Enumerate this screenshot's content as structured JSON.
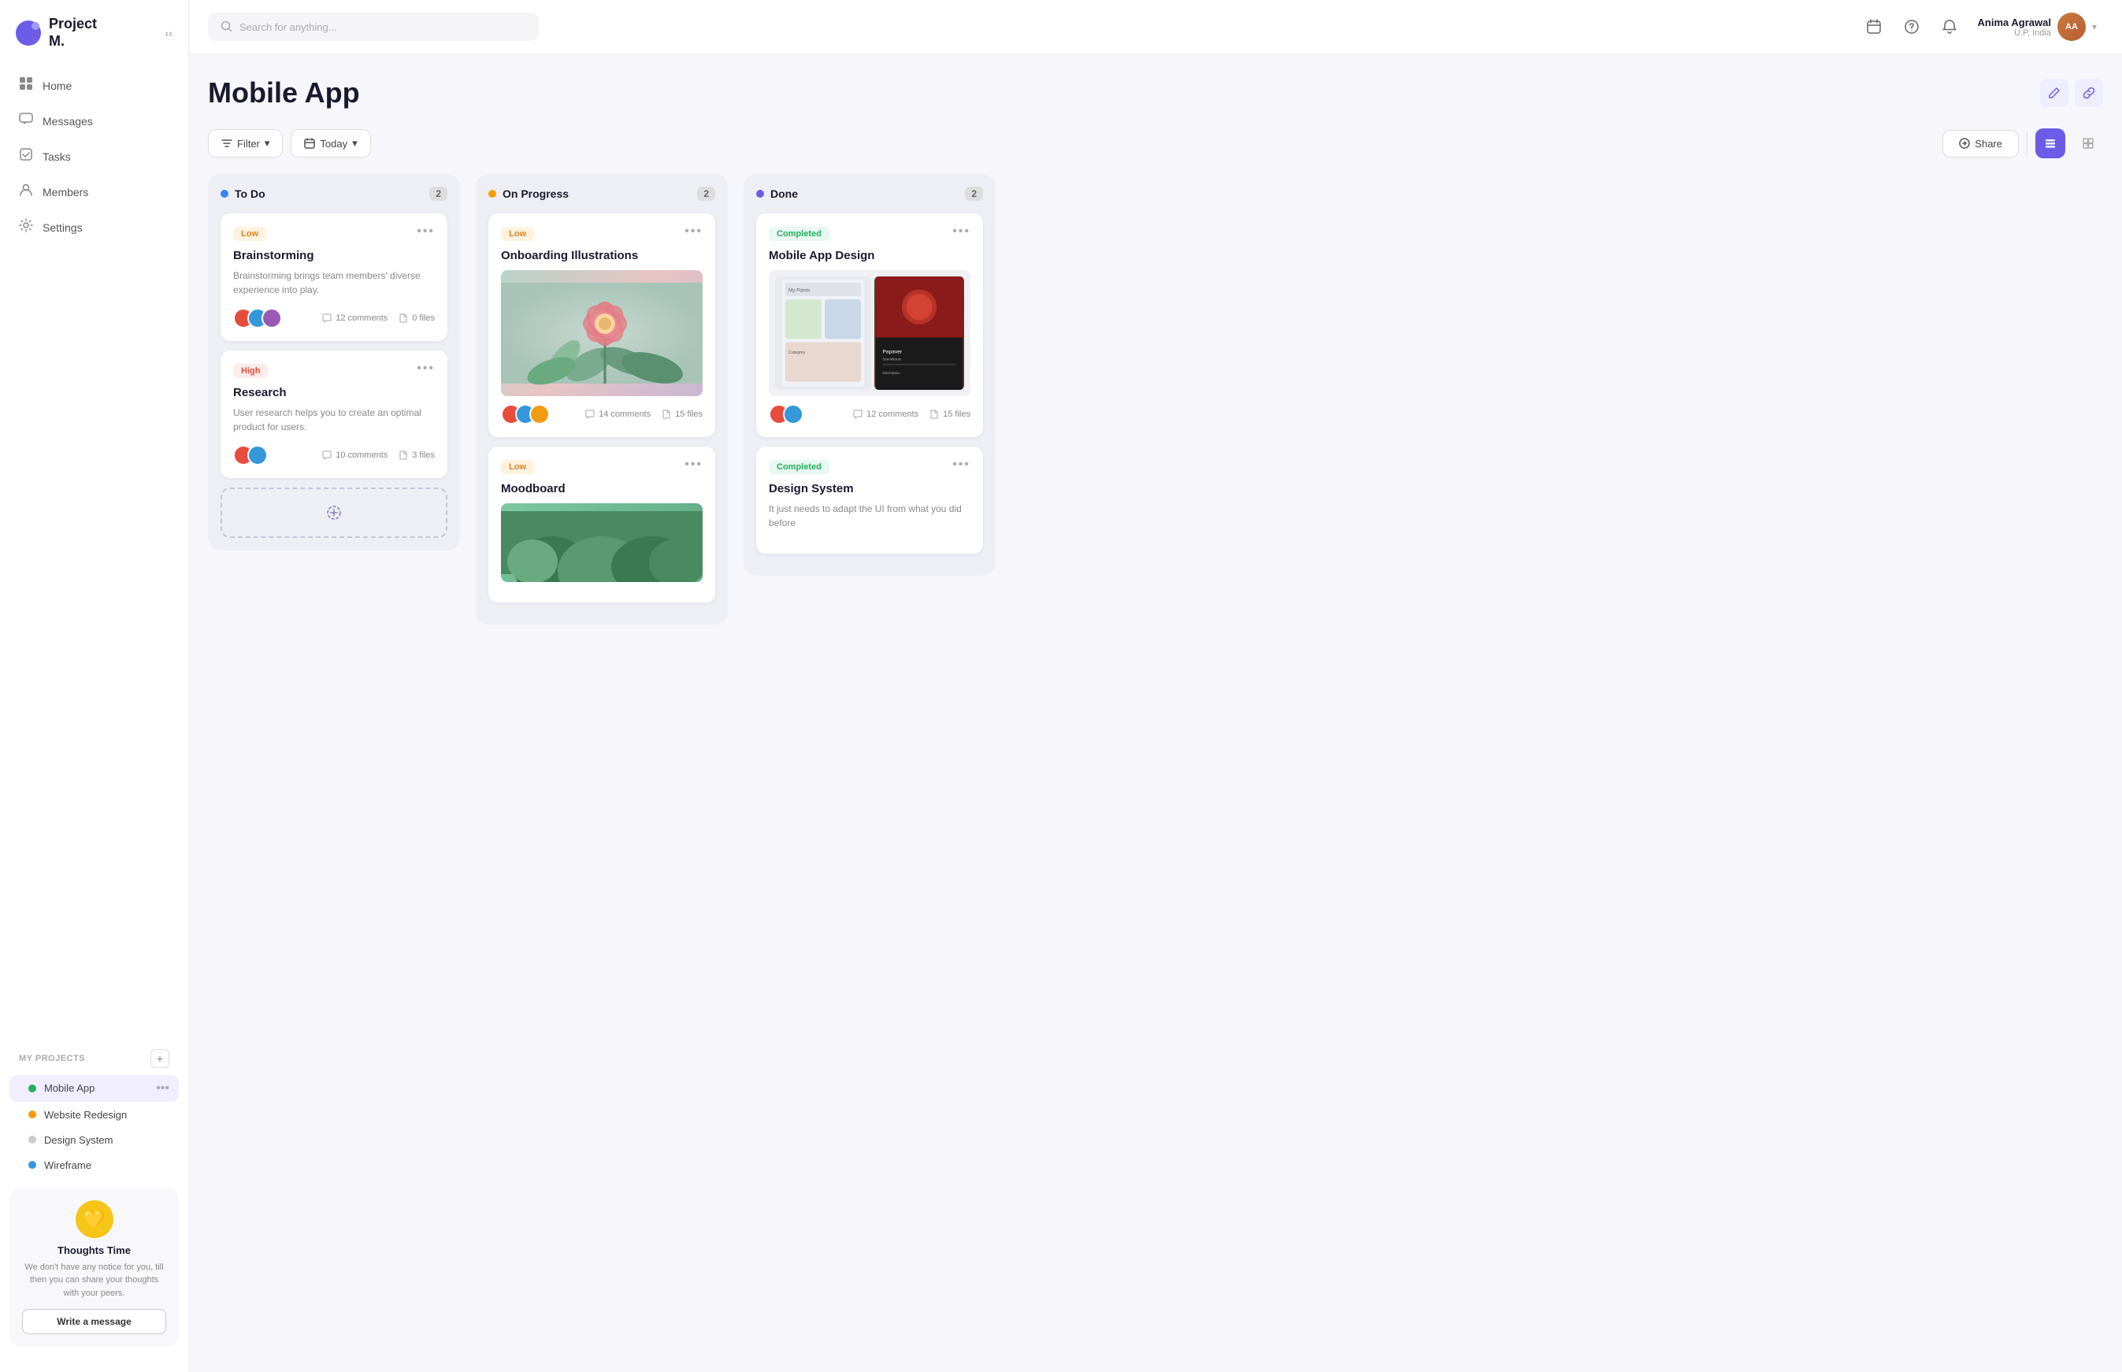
{
  "brand": {
    "name": "Project\nM.",
    "icon": "P"
  },
  "sidebar": {
    "nav_items": [
      {
        "id": "home",
        "label": "Home",
        "icon": "⊞"
      },
      {
        "id": "messages",
        "label": "Messages",
        "icon": "💬"
      },
      {
        "id": "tasks",
        "label": "Tasks",
        "icon": "☑"
      },
      {
        "id": "members",
        "label": "Members",
        "icon": "👤"
      },
      {
        "id": "settings",
        "label": "Settings",
        "icon": "⚙"
      }
    ],
    "projects_label": "MY PROJECTS",
    "projects": [
      {
        "id": "mobile-app",
        "label": "Mobile App",
        "color": "#27ae60",
        "active": true
      },
      {
        "id": "website-redesign",
        "label": "Website Redesign",
        "color": "#f39c12",
        "active": false
      },
      {
        "id": "design-system",
        "label": "Design System",
        "color": "#ccc",
        "active": false
      },
      {
        "id": "wireframe",
        "label": "Wireframe",
        "color": "#3498db",
        "active": false
      }
    ]
  },
  "thoughts": {
    "title": "Thoughts Time",
    "body": "We don't have any notice for you, till then you can share your thoughts with your peers.",
    "button_label": "Write a message"
  },
  "header": {
    "search_placeholder": "Search for anything...",
    "user": {
      "name": "Anima Agrawal",
      "location": "U.P, India",
      "initials": "AA"
    }
  },
  "board": {
    "title": "Mobile App",
    "filter_label": "Filter",
    "today_label": "Today",
    "share_label": "Share",
    "columns": [
      {
        "id": "todo",
        "title": "To Do",
        "color": "#3b82f6",
        "count": 2,
        "cards": [
          {
            "id": "brainstorming",
            "badge": "Low",
            "badge_type": "low",
            "title": "Brainstorming",
            "desc": "Brainstorming brings team members' diverse experience into play.",
            "comments": "12 comments",
            "files": "0 files",
            "avatars": [
              "#e74c3c",
              "#3498db",
              "#9b59b6"
            ]
          },
          {
            "id": "research",
            "badge": "High",
            "badge_type": "high",
            "title": "Research",
            "desc": "User research helps you to create an optimal product for users.",
            "comments": "10 comments",
            "files": "3 files",
            "avatars": [
              "#e74c3c",
              "#3498db"
            ]
          }
        ]
      },
      {
        "id": "on-progress",
        "title": "On Progress",
        "color": "#f59e0b",
        "count": 2,
        "cards": [
          {
            "id": "onboarding-illustrations",
            "badge": "Low",
            "badge_type": "low",
            "title": "Onboarding Illustrations",
            "desc": "",
            "has_image": true,
            "image_type": "flower",
            "comments": "14 comments",
            "files": "15 files",
            "avatars": [
              "#e74c3c",
              "#3498db",
              "#f39c12"
            ]
          },
          {
            "id": "moodboard",
            "badge": "Low",
            "badge_type": "low",
            "title": "Moodboard",
            "desc": "",
            "has_image": true,
            "image_type": "plant",
            "comments": "",
            "files": "",
            "avatars": []
          }
        ]
      },
      {
        "id": "done",
        "title": "Done",
        "color": "#6c5ce7",
        "count": 2,
        "cards": [
          {
            "id": "mobile-app-design",
            "badge": "Completed",
            "badge_type": "completed",
            "title": "Mobile App Design",
            "desc": "",
            "has_image": true,
            "image_type": "app-design",
            "comments": "12 comments",
            "files": "15 files",
            "avatars": [
              "#e74c3c",
              "#3498db"
            ]
          },
          {
            "id": "design-system",
            "badge": "Completed",
            "badge_type": "completed",
            "title": "Design System",
            "desc": "It just needs to adapt the UI from what you did before",
            "comments": "",
            "files": "",
            "avatars": []
          }
        ]
      }
    ]
  }
}
